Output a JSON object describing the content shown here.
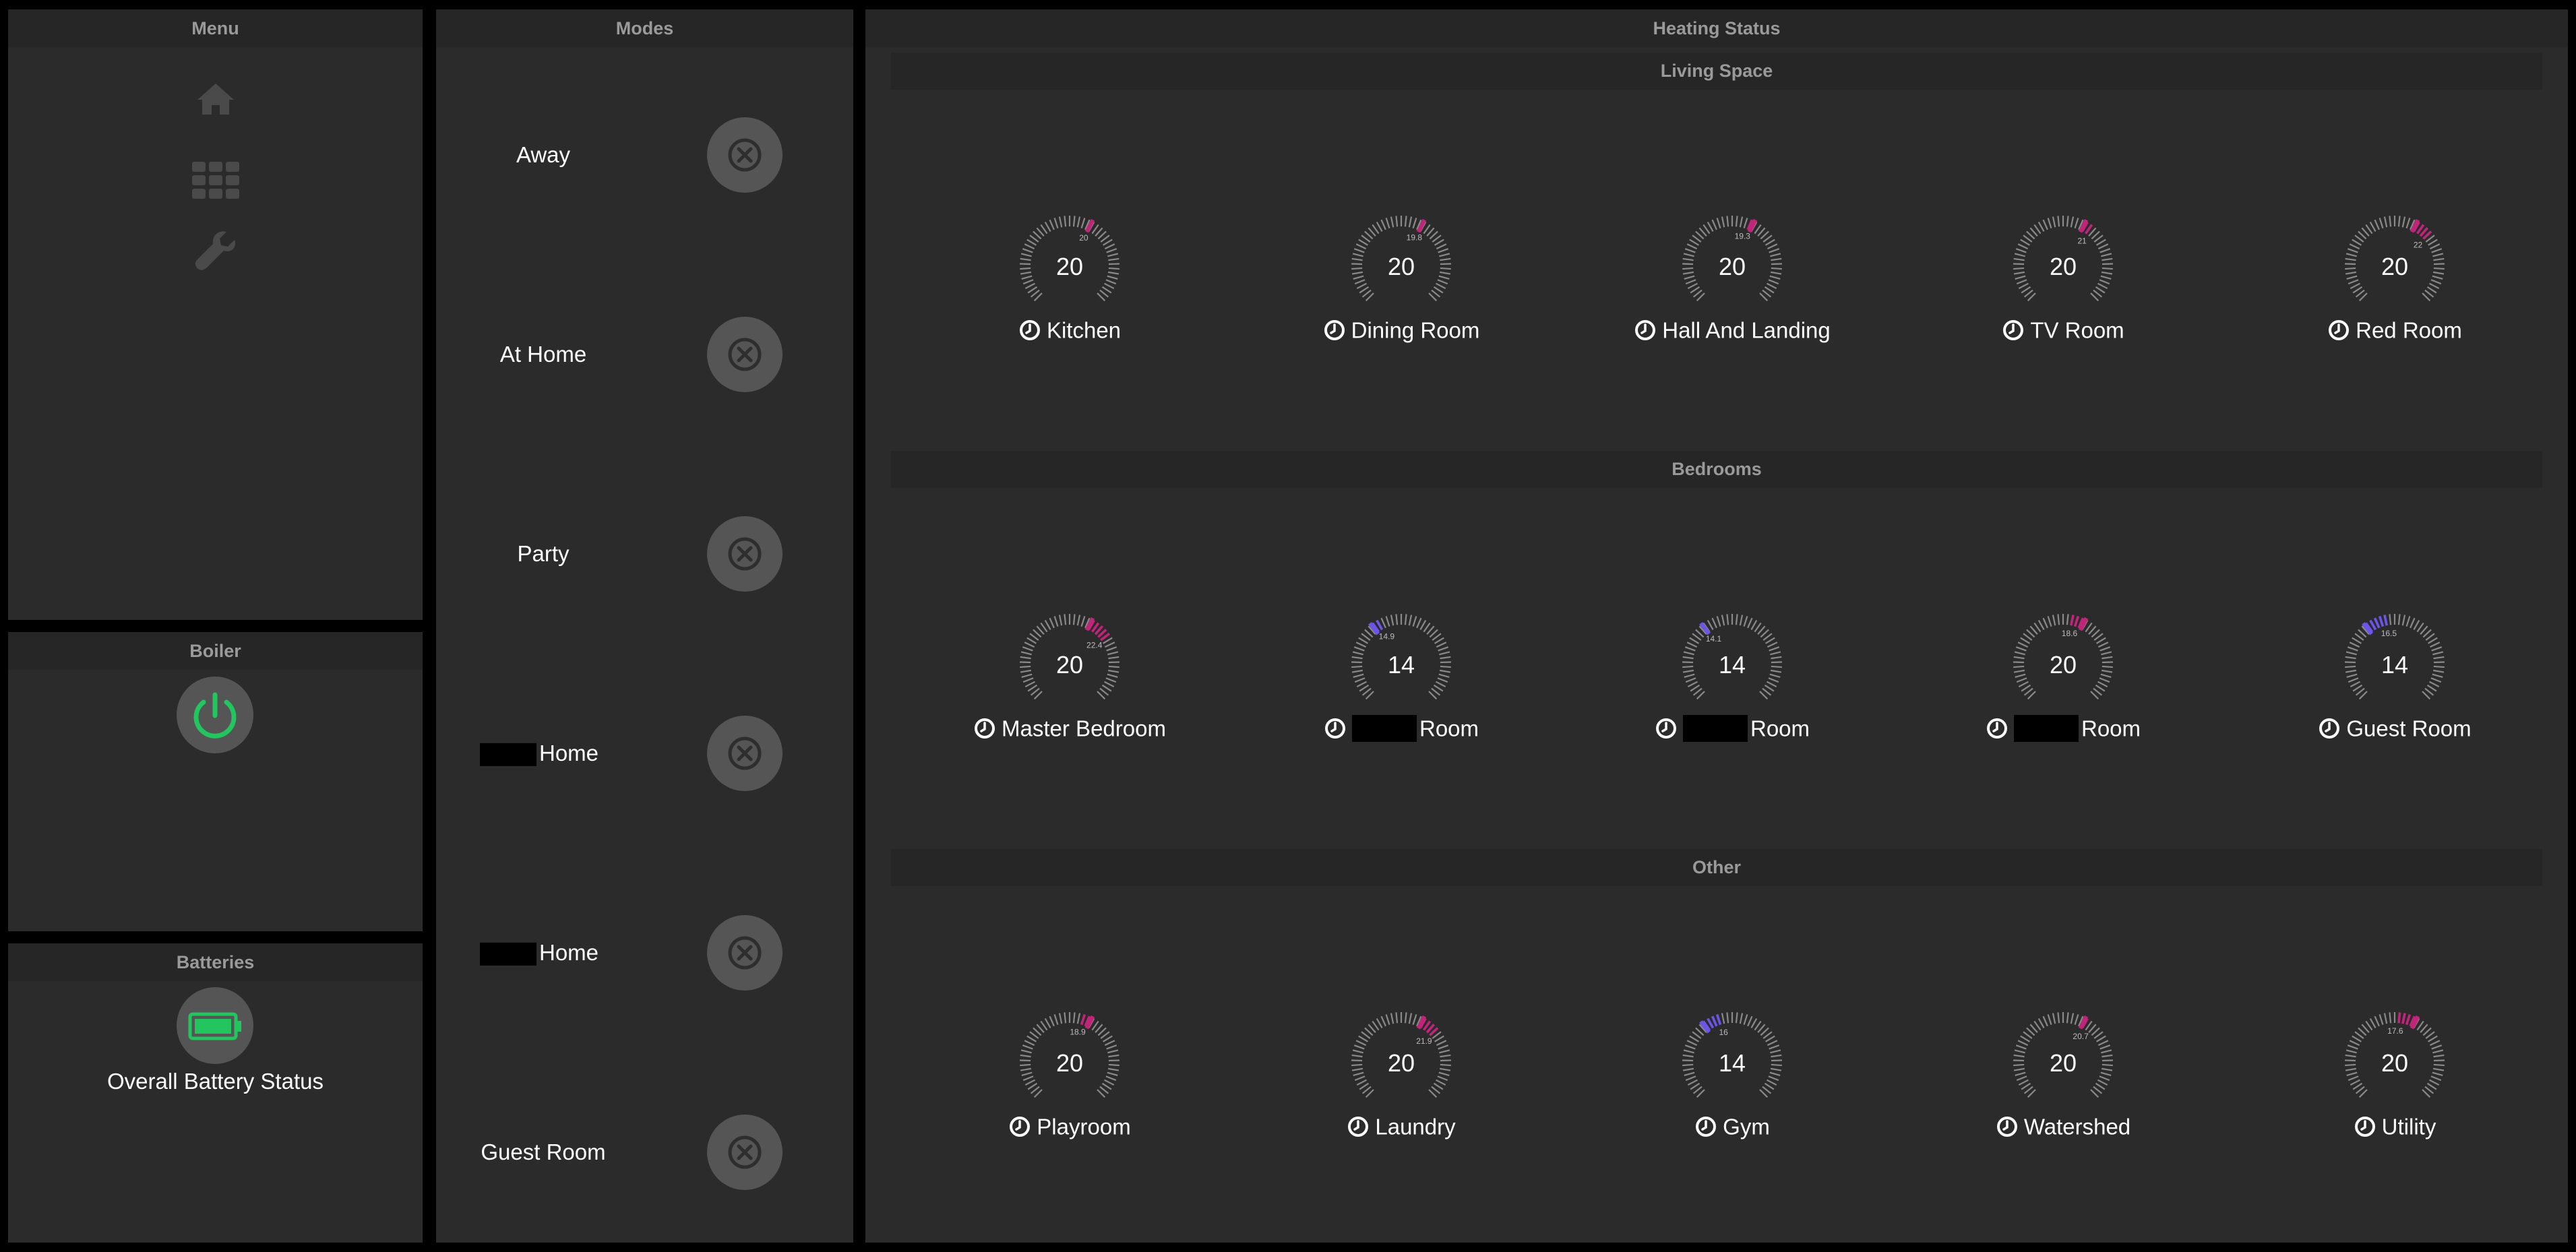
{
  "menu": {
    "title": "Menu",
    "items": [
      "home-icon",
      "grid-icon",
      "wrench-icon"
    ]
  },
  "boiler": {
    "title": "Boiler",
    "status_color": "#22c55e"
  },
  "batteries": {
    "title": "Batteries",
    "label": "Overall Battery Status",
    "status_color": "#22c55e"
  },
  "modes": {
    "title": "Modes",
    "items": [
      {
        "label": "Away",
        "redacted": false
      },
      {
        "label": "At Home",
        "redacted": false
      },
      {
        "label": "Party",
        "redacted": false
      },
      {
        "label": "Home",
        "redacted": true
      },
      {
        "label": "Home",
        "redacted": true
      },
      {
        "label": "Guest Room",
        "redacted": false
      }
    ]
  },
  "heating": {
    "title": "Heating Status",
    "sections": [
      {
        "title": "Living Space",
        "rooms": [
          {
            "name": "Kitchen",
            "setpoint": "20",
            "current": "20",
            "redacted": false
          },
          {
            "name": "Dining Room",
            "setpoint": "20",
            "current": "19.8",
            "redacted": false
          },
          {
            "name": "Hall And Landing",
            "setpoint": "20",
            "current": "19.3",
            "redacted": false
          },
          {
            "name": "TV Room",
            "setpoint": "20",
            "current": "21",
            "redacted": false
          },
          {
            "name": "Red Room",
            "setpoint": "20",
            "current": "22",
            "redacted": false
          }
        ]
      },
      {
        "title": "Bedrooms",
        "rooms": [
          {
            "name": "Master Bedroom",
            "setpoint": "20",
            "current": "22.4",
            "redacted": false
          },
          {
            "name": "Room",
            "setpoint": "14",
            "current": "14.9",
            "redacted": true
          },
          {
            "name": "Room",
            "setpoint": "14",
            "current": "14.1",
            "redacted": true
          },
          {
            "name": "Room",
            "setpoint": "20",
            "current": "18.6",
            "redacted": true
          },
          {
            "name": "Guest Room",
            "setpoint": "14",
            "current": "16.5",
            "redacted": false
          }
        ]
      },
      {
        "title": "Other",
        "rooms": [
          {
            "name": "Playroom",
            "setpoint": "20",
            "current": "18.9",
            "redacted": false
          },
          {
            "name": "Laundry",
            "setpoint": "20",
            "current": "21.9",
            "redacted": false
          },
          {
            "name": "Gym",
            "setpoint": "14",
            "current": "16",
            "redacted": false
          },
          {
            "name": "Watershed",
            "setpoint": "20",
            "current": "20.7",
            "redacted": false
          },
          {
            "name": "Utility",
            "setpoint": "20",
            "current": "17.6",
            "redacted": false
          }
        ]
      }
    ]
  },
  "colors": {
    "warm": "#c0257a",
    "cool": "#6d55e8",
    "tick": "#8a8a8a",
    "panel": "#2b2b2b",
    "header": "#262626"
  }
}
